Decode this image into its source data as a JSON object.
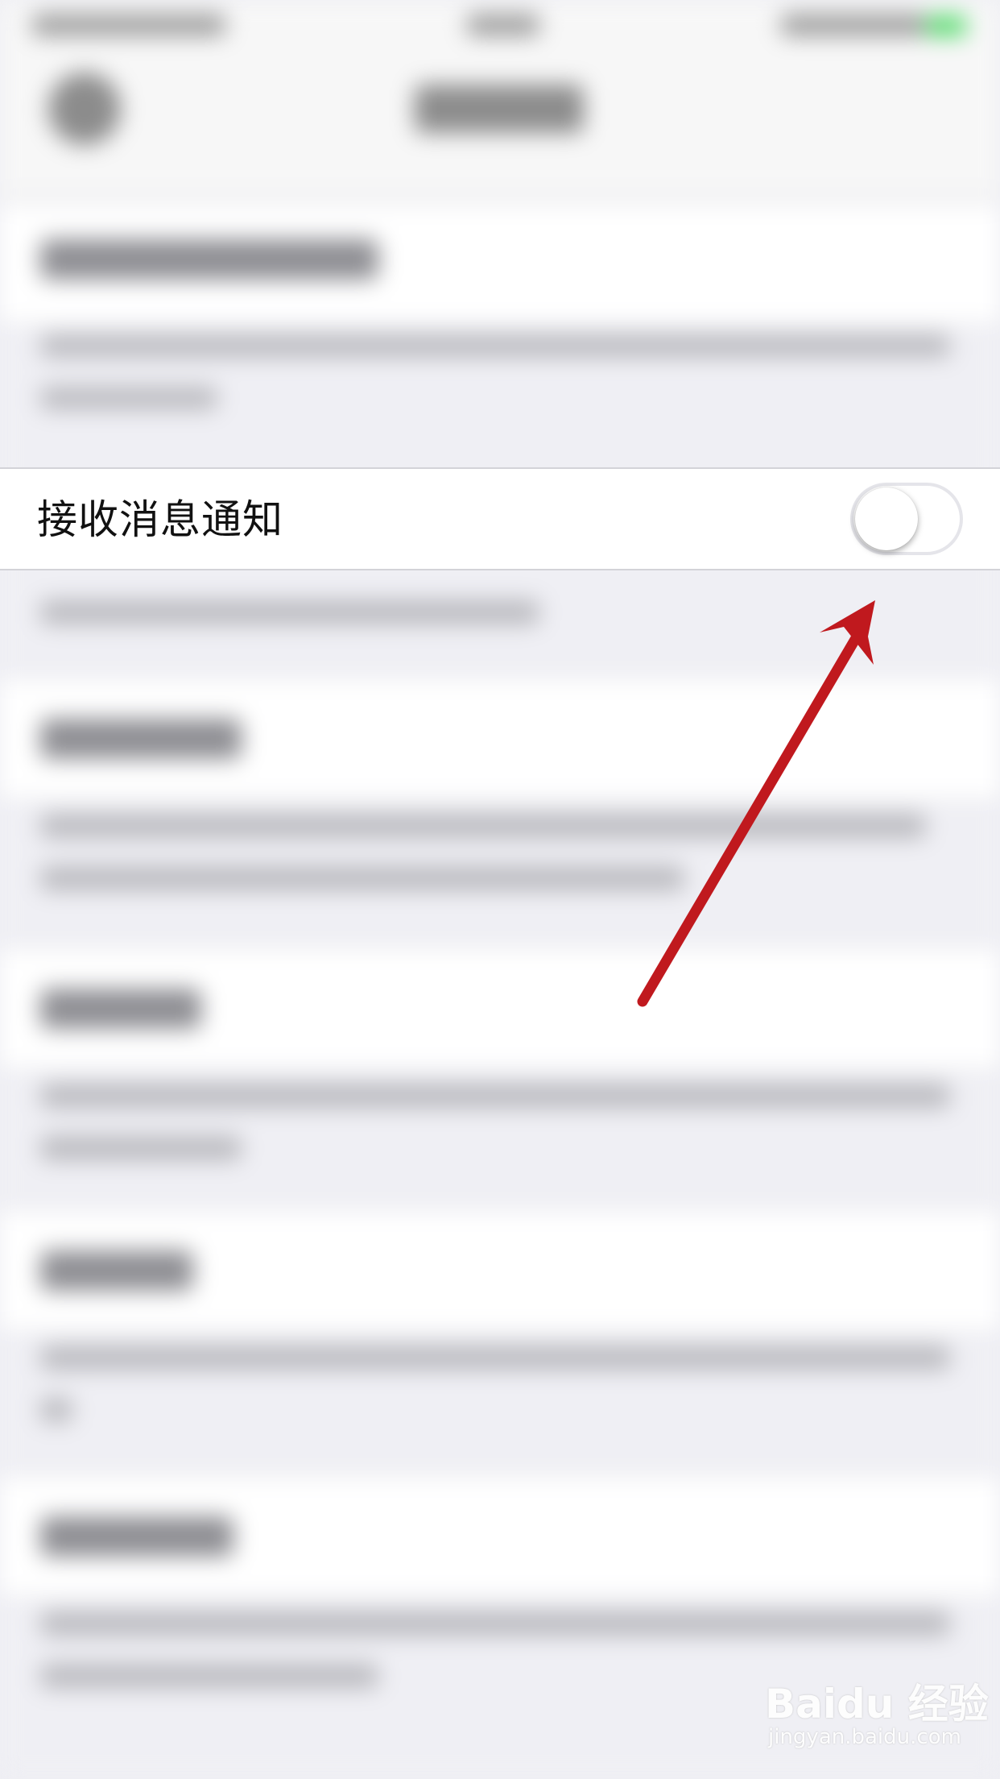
{
  "settings": {
    "notification_row": {
      "label": "接收消息通知",
      "toggle_on": false
    }
  },
  "annotation": {
    "arrow_color": "#c0191e",
    "arrow_target": "notification-toggle"
  },
  "watermark": {
    "logo_text": "Baidu 经验",
    "url": "jingyan.baidu.com"
  },
  "colors": {
    "background": "#efeff4",
    "row_background": "#ffffff",
    "toggle_off_border": "#e5e5ea",
    "arrow": "#c0191e"
  }
}
